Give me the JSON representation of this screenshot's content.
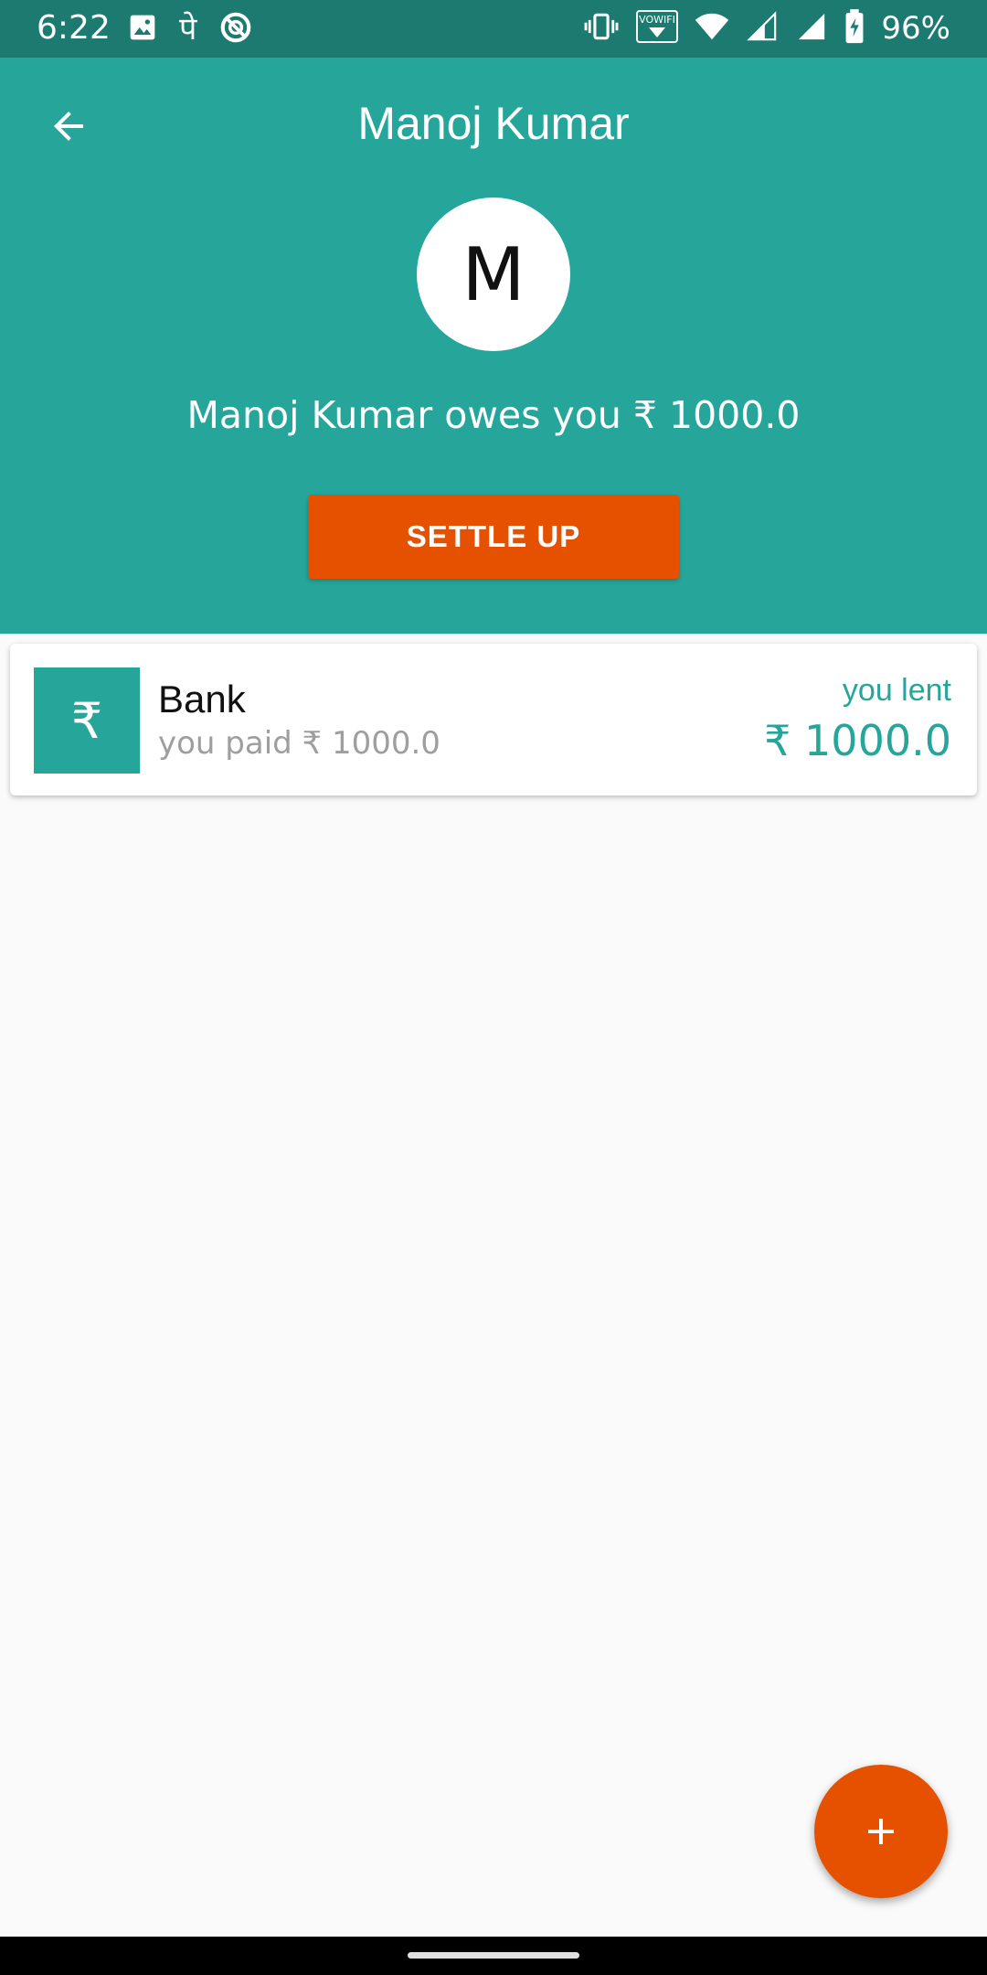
{
  "status_bar": {
    "time": "6:22",
    "left_icons": [
      "image-icon",
      "phonepe-icon",
      "data-saver-icon"
    ],
    "right_icons": [
      "vibrate-icon",
      "vowifi-icon",
      "wifi-icon",
      "cellular-signal-icon",
      "battery-charging-icon"
    ],
    "vowifi_label": "VOWIFI",
    "phonepe_glyph": "पे",
    "battery": "96%"
  },
  "header": {
    "title": "Manoj Kumar",
    "avatar_initial": "M",
    "balance_text": "Manoj Kumar owes you ₹ 1000.0",
    "settle_button": "SETTLE UP",
    "background_color": "#26a69a"
  },
  "transactions": [
    {
      "icon": "rupee-icon",
      "icon_glyph": "₹",
      "title": "Bank",
      "subtitle": "you paid ₹ 1000.0",
      "status_label": "you lent",
      "amount": "₹ 1000.0"
    }
  ],
  "fab": {
    "icon": "plus-icon",
    "color": "#e65100"
  },
  "colors": {
    "primary": "#26a69a",
    "status_bar": "#1c7a70",
    "accent": "#e65100",
    "background": "#fafafa",
    "muted_text": "#9e9e9e"
  }
}
